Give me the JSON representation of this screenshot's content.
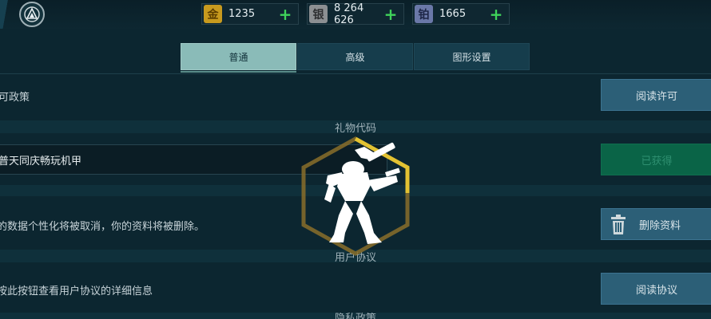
{
  "currencies": {
    "gold": {
      "icon_char": "金",
      "value": "1235",
      "icon": "gold-coin-icon",
      "color": "#c89a1e"
    },
    "silver": {
      "icon_char": "银",
      "value": "8 264 626",
      "icon": "silver-coin-icon",
      "color": "#8c8f92"
    },
    "platinum": {
      "icon_char": "铂",
      "value": "1665",
      "icon": "platinum-coin-icon",
      "color": "#6a78a8"
    }
  },
  "tabs": [
    {
      "label": "普通",
      "active": true
    },
    {
      "label": "高级",
      "active": false
    },
    {
      "label": "图形设置",
      "active": false
    }
  ],
  "rows": {
    "privacy_text": "可政策",
    "read_license_button": "阅读许可",
    "gift_code_header": "礼物代码",
    "gift_code_value": "普天同庆畅玩机甲",
    "obtained_button": "已获得",
    "delete_text": "的数据个性化将被取消，你的资料将被删除。",
    "delete_button": "删除资料",
    "user_agreement_header": "用户协议",
    "agreement_text": "按此按钮查看用户协议的详细信息",
    "read_agreement_button": "阅读协议",
    "privacy_header_partial": "隐私政策"
  },
  "colors": {
    "accent_tab": "#8abbb8",
    "button_blue": "#2c5f77",
    "button_green": "#0a6447",
    "loading_gold": "#d8b830"
  }
}
